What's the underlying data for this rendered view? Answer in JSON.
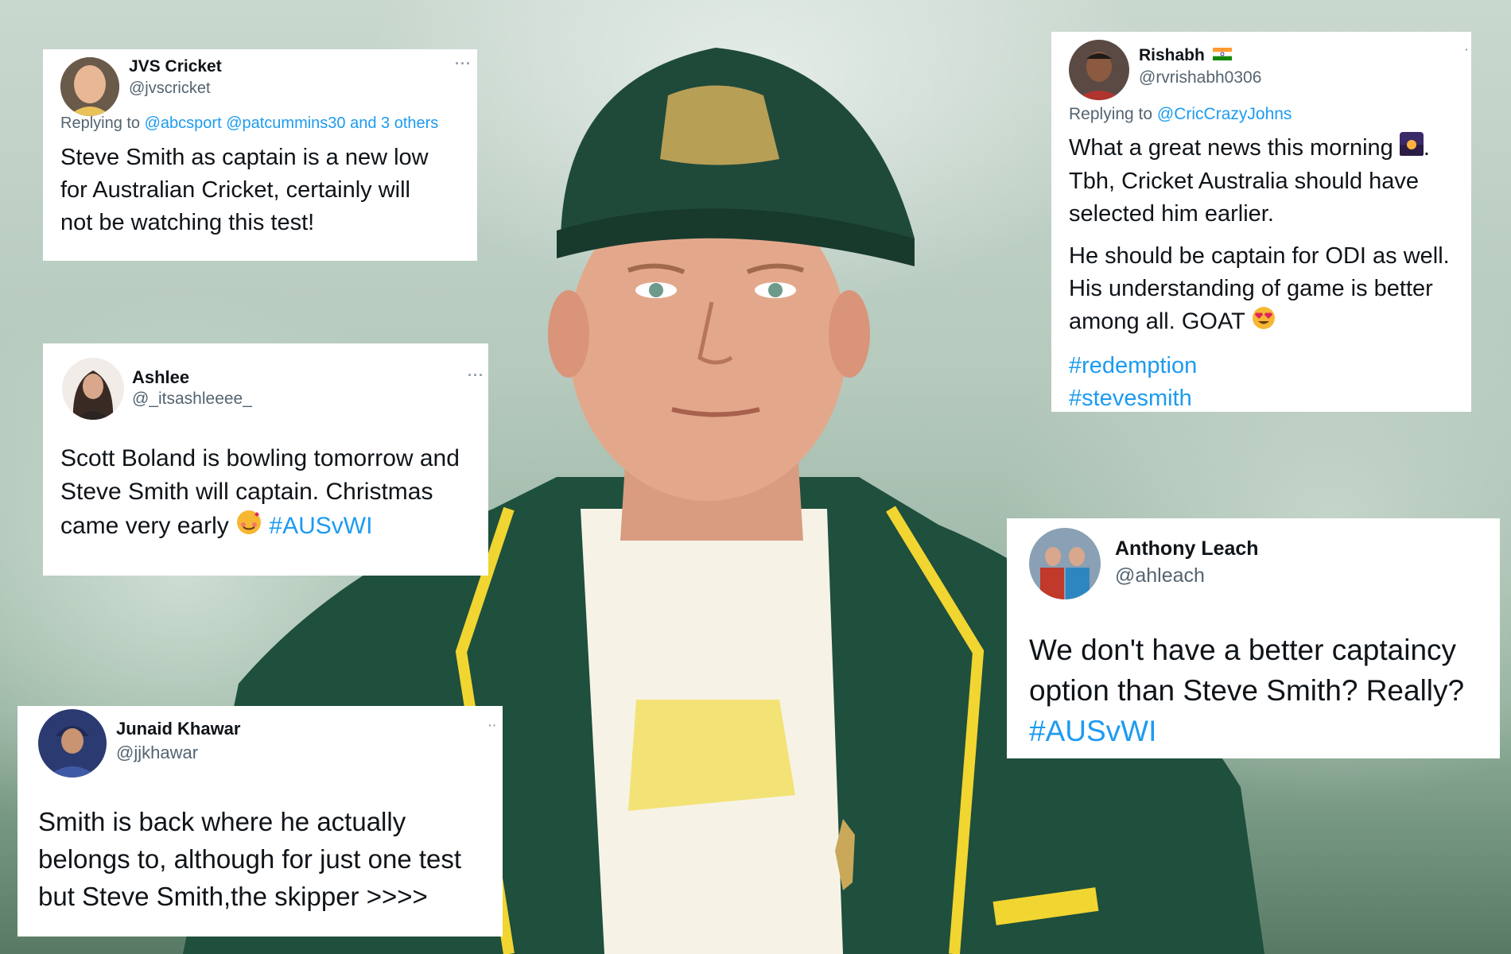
{
  "tweets": {
    "jvs": {
      "name": "JVS Cricket",
      "handle": "@jvscricket",
      "replying_prefix": "Replying to",
      "replying_to": "@abcsport @patcummins30 and 3 others",
      "lines": [
        "Steve Smith as captain is a new low",
        "for Australian Cricket, certainly will",
        "not be watching this test!"
      ]
    },
    "ashlee": {
      "name": "Ashlee",
      "handle": "@_itsashleeee_",
      "lines": [
        "Scott Boland is bowling tomorrow and",
        "Steve Smith will captain. Christmas",
        "came very early"
      ],
      "hashtag": "#AUSvWI"
    },
    "junaid": {
      "name": "Junaid Khawar",
      "handle": "@jjkhawar",
      "lines": [
        "Smith is back where he actually",
        "belongs to, although for just one test",
        "but Steve Smith,the skipper >>>>"
      ]
    },
    "rishabh": {
      "name": "Rishabh",
      "handle": "@rvrishabh0306",
      "replying_prefix": "Replying to",
      "replying_to": "@CricCrazyJohns",
      "para1": [
        "What a great news this morning",
        "Tbh, Cricket Australia should have",
        "selected him earlier."
      ],
      "para2": [
        "He should be captain for ODI as well.",
        "His understanding of game is better",
        "among all. GOAT"
      ],
      "hashtags": [
        "#redemption",
        "#stevesmith"
      ]
    },
    "anthony": {
      "name": "Anthony Leach",
      "handle": "@ahleach",
      "lines": [
        "We don't have a better captaincy",
        "option than Steve Smith? Really?"
      ],
      "hashtag": "#AUSvWI"
    }
  },
  "icons": {
    "more": "more-options-icon",
    "flag": "india-flag-icon"
  },
  "colors": {
    "link": "#1d9bf0",
    "text": "#0f1419",
    "secondary": "#536471",
    "cap": "#1f4a3a",
    "badge": "#c9a85a"
  }
}
